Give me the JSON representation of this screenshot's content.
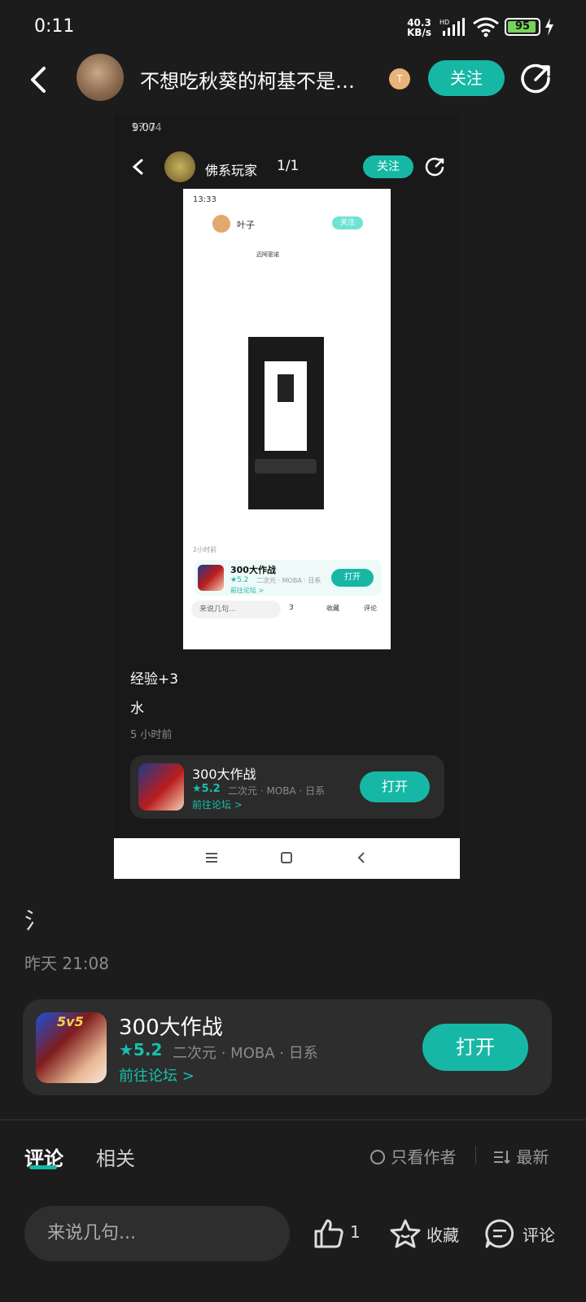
{
  "status_bar": {
    "time": "0:11",
    "net_speed": "40.3",
    "net_unit": "KB/s",
    "net_tag": "HD",
    "battery": "95",
    "battery_level": 0.95
  },
  "header": {
    "title": "不想吃秋葵的柯基不是…",
    "badge": "T",
    "follow_label": "关注"
  },
  "embedded_screenshot": {
    "status_time": "9:07",
    "status_time_2": "17:04",
    "header_name": "佛系玩家",
    "header_count": "1/1",
    "follow_label": "关注",
    "inner_time": "13:33",
    "inner_name": "叶子",
    "inner_follow": "关注",
    "inner_small_name": "迈阿密诺",
    "inner_time_ago": "2小时前",
    "inner_game_name": "300大作战",
    "inner_rating": "★5.2",
    "inner_tags": "二次元 · MOBA · 日系",
    "inner_open": "打开",
    "inner_forum": "前往论坛 >",
    "inner_comment_placeholder": "来说几句...",
    "inner_likes": "3",
    "inner_fav": "收藏",
    "inner_comment": "评论",
    "post_line1": "经验+3",
    "post_line2": "水",
    "post_time": "5 小时前",
    "game_name": "300大作战",
    "rating": "★5.2",
    "tags": "二次元 · MOBA · 日系",
    "forum": "前往论坛 >",
    "open_label": "打开"
  },
  "post": {
    "glyph": "氵",
    "time_ago": "昨天 21:08"
  },
  "game_card": {
    "icon_label": "5v5",
    "name": "300大作战",
    "rating": "★5.2",
    "tags": "二次元 · MOBA · 日系",
    "forum_link": "前往论坛 >",
    "open_label": "打开"
  },
  "tabs": {
    "comments": "评论",
    "related": "相关",
    "only_author": "只看作者",
    "newest": "最新"
  },
  "bottom_bar": {
    "input_placeholder": "来说几句...",
    "like_count": "1",
    "fav_label": "收藏",
    "comment_label": "评论"
  },
  "colors": {
    "accent": "#16b8a5",
    "background": "#1c1c1c",
    "card": "#2d2d2d"
  }
}
